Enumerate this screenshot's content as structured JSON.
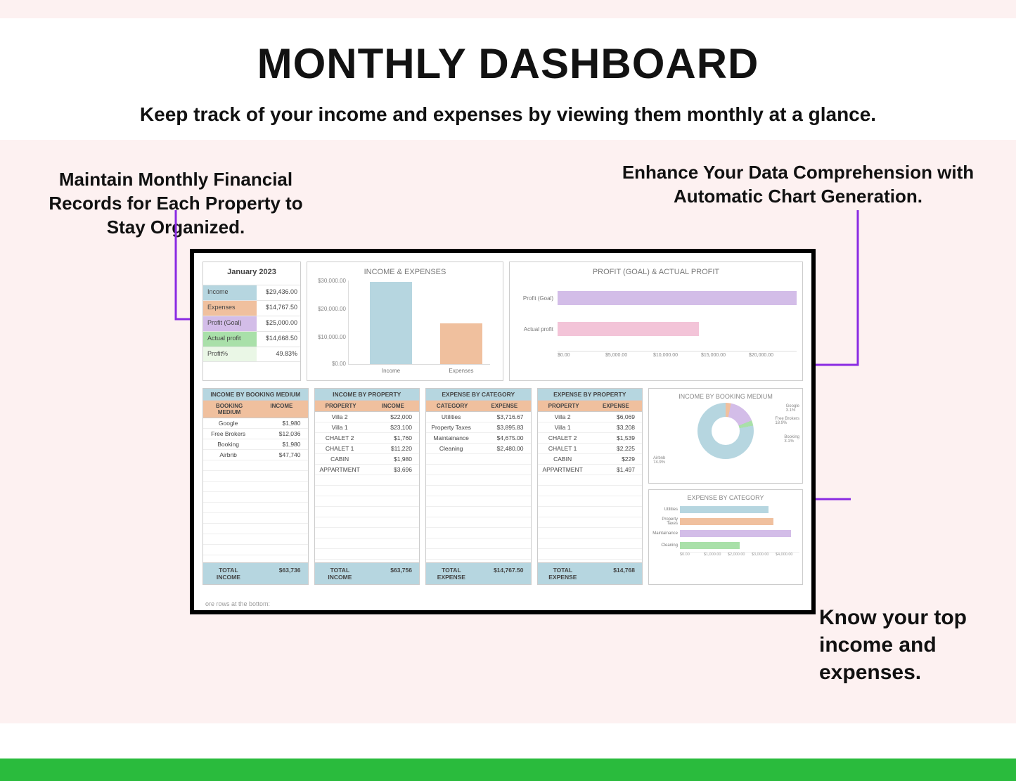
{
  "title": "MONTHLY DASHBOARD",
  "subtitle": "Keep track of your income and expenses by viewing them monthly at a glance.",
  "callouts": {
    "left": "Maintain Monthly Financial Records for Each Property to Stay Organized.",
    "right": "Enhance Your Data Comprehension with Automatic Chart Generation.",
    "bottom": "Know your top income and expenses."
  },
  "summary": {
    "month": "January 2023",
    "rows": [
      {
        "label": "Income",
        "value": "$29,436.00"
      },
      {
        "label": "Expenses",
        "value": "$14,767.50"
      },
      {
        "label": "Profit (Goal)",
        "value": "$25,000.00"
      },
      {
        "label": "Actual profit",
        "value": "$14,668.50"
      },
      {
        "label": "Profit%",
        "value": "49.83%"
      }
    ]
  },
  "chart_data": [
    {
      "type": "bar",
      "title": "INCOME & EXPENSES",
      "categories": [
        "Income",
        "Expenses"
      ],
      "values": [
        29436,
        14767.5
      ],
      "yticks": [
        "$0.00",
        "$10,000.00",
        "$20,000.00",
        "$30,000.00"
      ],
      "ylim": [
        0,
        30000
      ]
    },
    {
      "type": "bar-horizontal",
      "title": "PROFIT (GOAL) & ACTUAL PROFIT",
      "categories": [
        "Profit (Goal)",
        "Actual profit"
      ],
      "values": [
        25000,
        14668.5
      ],
      "xticks": [
        "$0.00",
        "$5,000.00",
        "$10,000.00",
        "$15,000.00",
        "$20,000.00"
      ],
      "xlim": [
        0,
        25000
      ]
    },
    {
      "type": "pie",
      "title": "INCOME BY BOOKING MEDIUM",
      "series": [
        {
          "name": "Google",
          "value": 1980,
          "pct": "3.1%"
        },
        {
          "name": "Free Brokers",
          "value": 12036,
          "pct": "18.9%"
        },
        {
          "name": "Booking",
          "value": 1980,
          "pct": "3.1%"
        },
        {
          "name": "Airbnb",
          "value": 47740,
          "pct": "74.9%"
        }
      ]
    },
    {
      "type": "bar-horizontal",
      "title": "EXPENSE BY CATEGORY",
      "categories": [
        "Utilities",
        "Property Taxes",
        "Maintainance",
        "Cleaning"
      ],
      "values": [
        3716.67,
        3895.83,
        4675.0,
        2480.0
      ],
      "xticks": [
        "$0.00",
        "$1,000.00",
        "$2,000.00",
        "$3,000.00",
        "$4,000.00"
      ],
      "xlim": [
        0,
        5000
      ]
    }
  ],
  "tables": {
    "t1": {
      "title": "INCOME BY BOOKING MEDIUM",
      "headers": [
        "BOOKING MEDIUM",
        "INCOME"
      ],
      "rows": [
        [
          "Google",
          "$1,980"
        ],
        [
          "Free Brokers",
          "$12,036"
        ],
        [
          "Booking",
          "$1,980"
        ],
        [
          "Airbnb",
          "$47,740"
        ]
      ],
      "footer": [
        "TOTAL INCOME",
        "$63,736"
      ]
    },
    "t2": {
      "title": "INCOME BY PROPERTY",
      "headers": [
        "PROPERTY",
        "INCOME"
      ],
      "rows": [
        [
          "Villa 2",
          "$22,000"
        ],
        [
          "Villa 1",
          "$23,100"
        ],
        [
          "CHALET 2",
          "$1,760"
        ],
        [
          "CHALET 1",
          "$11,220"
        ],
        [
          "CABIN",
          "$1,980"
        ],
        [
          "APPARTMENT",
          "$3,696"
        ]
      ],
      "footer": [
        "TOTAL INCOME",
        "$63,756"
      ]
    },
    "t3": {
      "title": "EXPENSE BY CATEGORY",
      "headers": [
        "CATEGORY",
        "EXPENSE"
      ],
      "rows": [
        [
          "Utilities",
          "$3,716.67"
        ],
        [
          "Property Taxes",
          "$3,895.83"
        ],
        [
          "Maintainance",
          "$4,675.00"
        ],
        [
          "Cleaning",
          "$2,480.00"
        ]
      ],
      "footer": [
        "TOTAL EXPENSE",
        "$14,767.50"
      ]
    },
    "t4": {
      "title": "EXPENSE BY PROPERTY",
      "headers": [
        "PROPERTY",
        "EXPENSE"
      ],
      "rows": [
        [
          "Villa 2",
          "$6,069"
        ],
        [
          "Villa 1",
          "$3,208"
        ],
        [
          "CHALET 2",
          "$1,539"
        ],
        [
          "CHALET 1",
          "$2,225"
        ],
        [
          "CABIN",
          "$229"
        ],
        [
          "APPARTMENT",
          "$1,497"
        ]
      ],
      "footer": [
        "TOTAL EXPENSE",
        "$14,768"
      ]
    }
  },
  "footer_note": "ore rows at the bottom:"
}
